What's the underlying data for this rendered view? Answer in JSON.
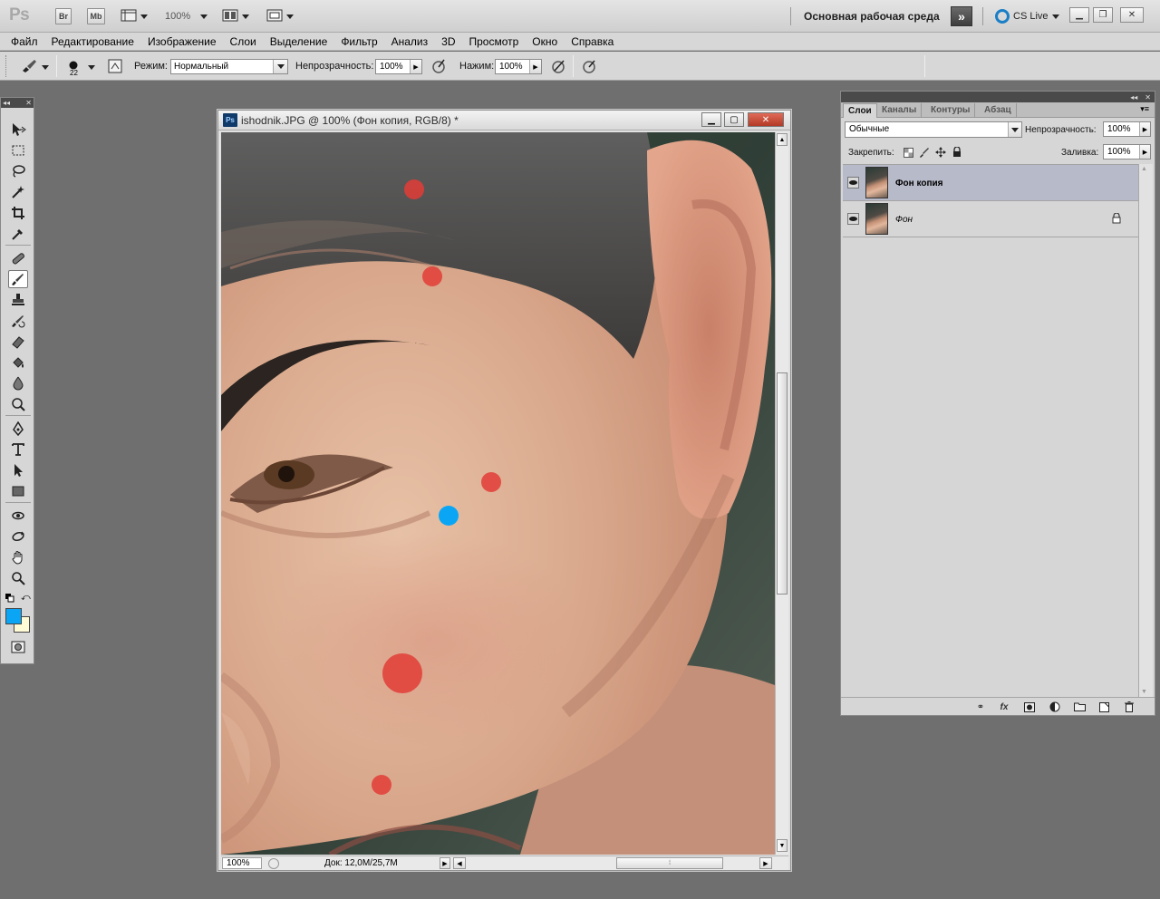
{
  "appbar": {
    "logo": "Ps",
    "bridge_label": "Br",
    "minibridge_label": "Mb",
    "zoom": "100%",
    "workspace": "Основная рабочая среда",
    "cslive": "CS Live"
  },
  "menu": [
    "Файл",
    "Редактирование",
    "Изображение",
    "Слои",
    "Выделение",
    "Фильтр",
    "Анализ",
    "3D",
    "Просмотр",
    "Окно",
    "Справка"
  ],
  "options": {
    "brush_size": "22",
    "mode_label": "Режим:",
    "mode_value": "Нормальный",
    "opacity_label": "Непрозрачность:",
    "opacity_value": "100%",
    "flow_label": "Нажим:",
    "flow_value": "100%"
  },
  "colors": {
    "foreground": "#0aa6f5",
    "background": "#fffbd6",
    "mark_red": "#e23c36",
    "mark_blue": "#0aa6f5"
  },
  "document": {
    "title": "ishodnik.JPG @ 100% (Фон копия, RGB/8) *",
    "zoom": "100%",
    "doc_info": "Док: 12,0M/25,7M"
  },
  "layers_panel": {
    "tabs": [
      "Слои",
      "Каналы",
      "Контуры",
      "Абзац"
    ],
    "blend_mode": "Обычные",
    "opacity_label": "Непрозрачность:",
    "opacity_value": "100%",
    "lock_label": "Закрепить:",
    "fill_label": "Заливка:",
    "fill_value": "100%",
    "layers": [
      {
        "name": "Фон копия",
        "selected": true
      },
      {
        "name": "Фон",
        "selected": false,
        "locked": true
      }
    ]
  }
}
